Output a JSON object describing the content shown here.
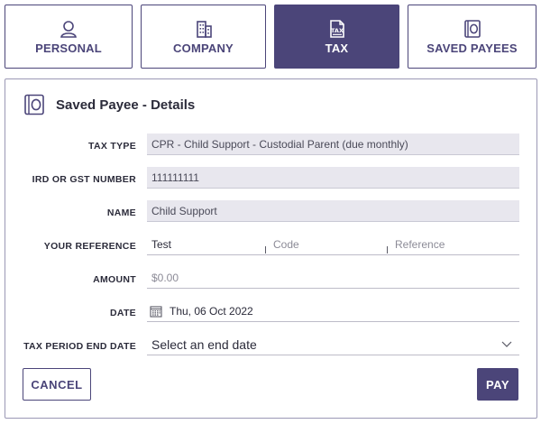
{
  "tabs": [
    {
      "label": "PERSONAL",
      "icon": "person-icon",
      "active": false
    },
    {
      "label": "COMPANY",
      "icon": "building-icon",
      "active": false
    },
    {
      "label": "TAX",
      "icon": "tax-document-icon",
      "active": true
    },
    {
      "label": "SAVED PAYEES",
      "icon": "saved-payee-icon",
      "active": false
    }
  ],
  "panel": {
    "title": "Saved Payee - Details",
    "icon": "saved-payee-icon"
  },
  "form": {
    "tax_type": {
      "label": "TAX TYPE",
      "value": "CPR - Child Support - Custodial Parent (due monthly)"
    },
    "ird_number": {
      "label": "IRD OR GST NUMBER",
      "value": "111111111"
    },
    "name": {
      "label": "NAME",
      "value": "Child Support"
    },
    "your_reference": {
      "label": "YOUR REFERENCE",
      "particulars_value": "Test",
      "code_placeholder": "Code",
      "reference_placeholder": "Reference"
    },
    "amount": {
      "label": "AMOUNT",
      "placeholder": "$0.00"
    },
    "date": {
      "label": "DATE",
      "value": "Thu, 06 Oct 2022",
      "icon": "calendar-icon"
    },
    "tax_period_end_date": {
      "label": "TAX PERIOD END DATE",
      "value": "Select an end date",
      "icon": "chevron-down-icon"
    }
  },
  "buttons": {
    "cancel": "CANCEL",
    "pay": "PAY"
  },
  "colors": {
    "accent": "#4b4579",
    "field_background": "#e8e7ee",
    "text": "#2b2b3a"
  }
}
